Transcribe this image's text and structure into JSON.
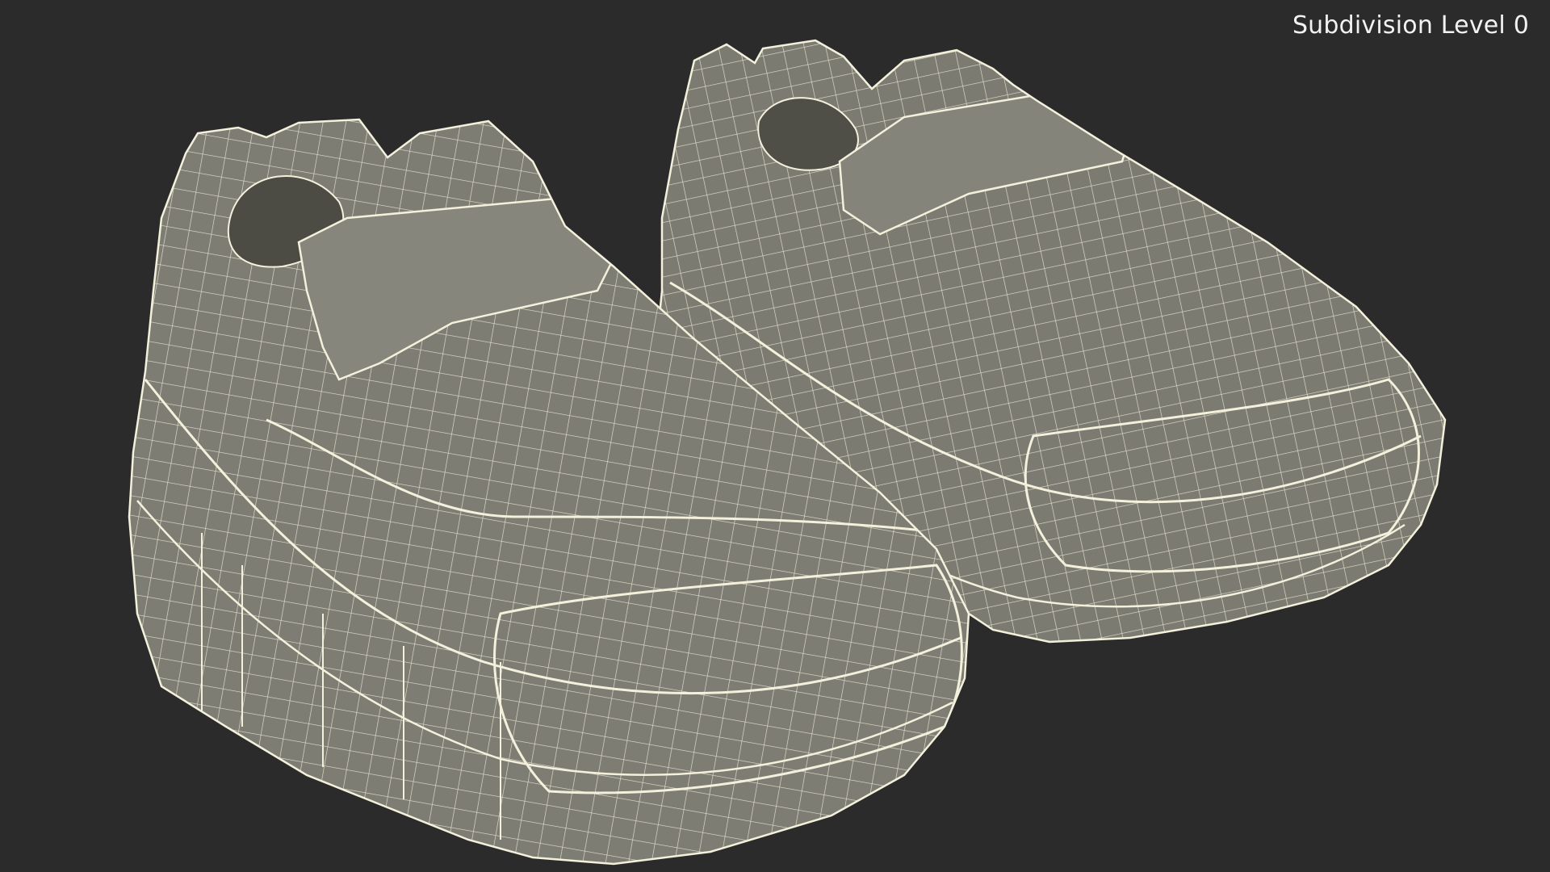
{
  "viewport": {
    "background_color": "#2b2b2b",
    "overlay_label": "Subdivision Level 0"
  },
  "model": {
    "shoe_fill_color": "#7b7b72",
    "shoe_shadow_color": "#4c4c45",
    "wire_color": "#f3f0dc"
  }
}
